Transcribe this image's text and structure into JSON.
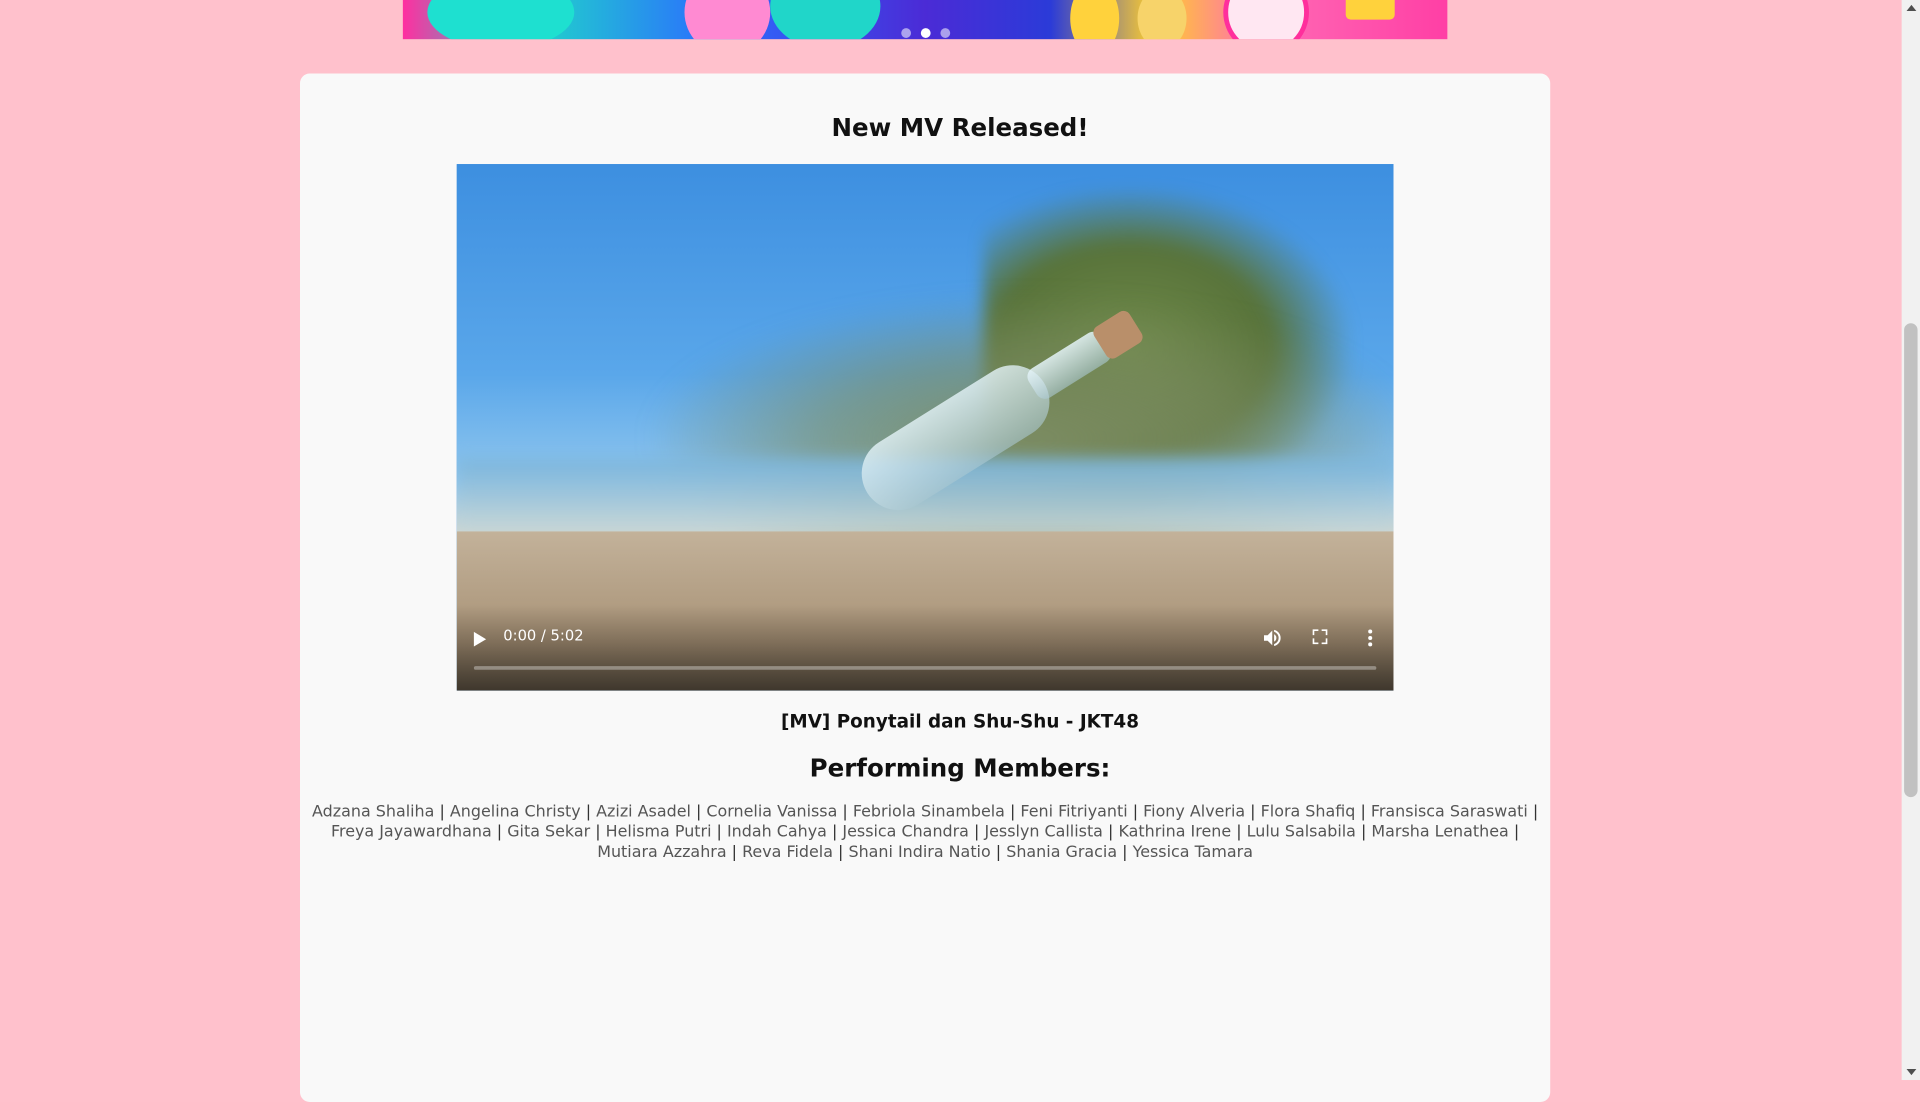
{
  "banner": {
    "slides_count": 3,
    "active_slide": 2,
    "colors": [
      "#ff2fa0",
      "#20d6c9",
      "#2b6dff",
      "#4b2bd6",
      "#ffcf2b"
    ]
  },
  "section": {
    "title": "New MV Released!"
  },
  "video": {
    "time_display": "0:00 / 5:02",
    "progress": 0,
    "icons": [
      "play-icon",
      "volume-icon",
      "fullscreen-icon",
      "more-options-icon"
    ]
  },
  "caption": "[MV] Ponytail dan Shu-Shu - JKT48",
  "members_heading": "Performing Members:",
  "members": [
    "Adzana Shaliha",
    "Angelina Christy",
    "Azizi Asadel",
    "Cornelia Vanissa",
    "Febriola Sinambela",
    "Feni Fitriyanti",
    "Fiony Alveria",
    "Flora Shafiq",
    "Fransisca Saraswati",
    "Freya Jayawardhana",
    "Gita Sekar",
    "Helisma Putri",
    "Indah Cahya",
    "Jessica Chandra",
    "Jesslyn Callista",
    "Kathrina Irene",
    "Lulu Salsabila",
    "Marsha Lenathea",
    "Mutiara Azzahra",
    "Reva Fidela",
    "Shani Indira Natio",
    "Shania Gracia",
    "Yessica Tamara"
  ],
  "members_separator": " | ",
  "theme": {
    "page_background": "#ffc1cc",
    "card_background": "#f9f9f9"
  }
}
